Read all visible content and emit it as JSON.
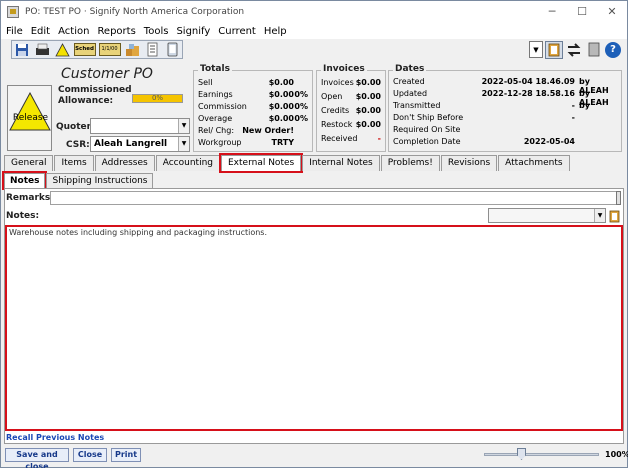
{
  "window": {
    "title": "PO: TEST PO · Signify North America Corporation",
    "controls": [
      "─",
      "☐",
      "✕"
    ]
  },
  "menu": [
    "File",
    "Edit",
    "Action",
    "Reports",
    "Tools",
    "Signify",
    "Current",
    "Help"
  ],
  "toolbar": {
    "sched_label": "Sched",
    "date_label": "1/1/00"
  },
  "header": {
    "title": "Customer PO",
    "commissioned_label": "Commissioned",
    "allowance_label": "Allowance:",
    "allowance_value": "0%",
    "release_label": "Release",
    "quoter_label": "Quoter:",
    "quoter_value": "",
    "csr_label": "CSR:",
    "csr_value": "Aleah Langrell"
  },
  "totals": {
    "title": "Totals",
    "rows": [
      {
        "label": "Sell",
        "value": "$0.00",
        "pct": ""
      },
      {
        "label": "Earnings",
        "value": "$0.00",
        "pct": "0%"
      },
      {
        "label": "Commission",
        "value": "$0.00",
        "pct": "0%"
      },
      {
        "label": "Overage",
        "value": "$0.00",
        "pct": "0%"
      },
      {
        "label": "Rel/ Chg:",
        "value": "New Order!",
        "pct": ""
      },
      {
        "label": "Workgroup",
        "value": "TRTY",
        "pct": ""
      }
    ]
  },
  "invoices": {
    "title": "Invoices",
    "rows": [
      {
        "label": "Invoices",
        "value": "$0.00"
      },
      {
        "label": "Open",
        "value": "$0.00"
      },
      {
        "label": "Credits",
        "value": "$0.00"
      },
      {
        "label": "Restock",
        "value": "$0.00"
      },
      {
        "label": "Received",
        "value": "-"
      }
    ]
  },
  "dates": {
    "title": "Dates",
    "rows": [
      {
        "label": "Created",
        "value": "2022-05-04 18.46.09",
        "by": "by ALEAH"
      },
      {
        "label": "Updated",
        "value": "2022-12-28 18.58.16",
        "by": "by ALEAH"
      },
      {
        "label": "Transmitted",
        "value": "-",
        "by": "by"
      },
      {
        "label": "Don't Ship Before",
        "value": "-",
        "by": ""
      },
      {
        "label": "Required On Site",
        "value": "",
        "by": ""
      },
      {
        "label": "Completion Date",
        "value": "2022-05-04",
        "by": ""
      }
    ]
  },
  "tabs": [
    "General",
    "Items",
    "Addresses",
    "Accounting",
    "External Notes",
    "Internal Notes",
    "Problems!",
    "Revisions",
    "Attachments"
  ],
  "active_tab": "External Notes",
  "subtabs": [
    "Notes",
    "Shipping Instructions"
  ],
  "notes_panel": {
    "remarks_label": "Remarks:",
    "remarks_value": "",
    "notes_label": "Notes:",
    "notes_text": "Warehouse notes including shipping and packaging instructions.",
    "recall_link": "Recall Previous Notes"
  },
  "footer": {
    "save_close": "Save and close",
    "close": "Close",
    "print": "Print",
    "zoom_label": "100%"
  },
  "colors": {
    "highlight": "#d6101a",
    "allowance_bar": "#f5c400",
    "link": "#1a47b5"
  }
}
